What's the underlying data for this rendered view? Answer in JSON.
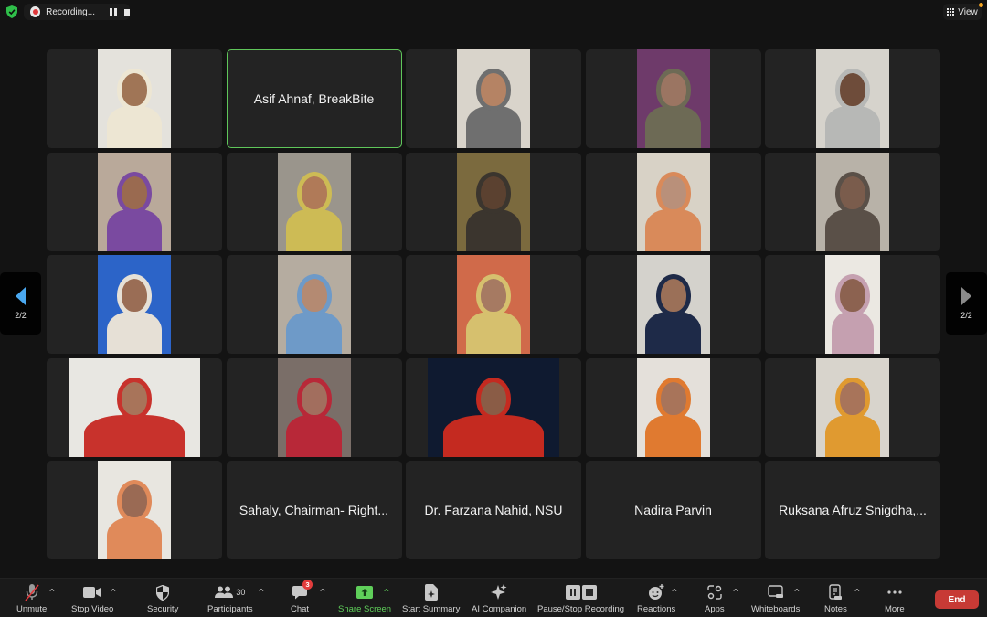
{
  "topbar": {
    "security_icon": "shield-check-icon",
    "recording_label": "Recording...",
    "view_label": "View",
    "view_notification": true
  },
  "pagination": {
    "left_label": "2/2",
    "right_label": "2/2"
  },
  "tiles": [
    {
      "type": "video",
      "name": "",
      "active": false
    },
    {
      "type": "name",
      "name": "Asif Ahnaf, BreakBite",
      "active": true
    },
    {
      "type": "video",
      "name": "",
      "active": false
    },
    {
      "type": "video",
      "name": "",
      "active": false
    },
    {
      "type": "video",
      "name": "",
      "active": false
    },
    {
      "type": "video",
      "name": "",
      "active": false
    },
    {
      "type": "video",
      "name": "",
      "active": false
    },
    {
      "type": "video",
      "name": "",
      "active": false
    },
    {
      "type": "video",
      "name": "",
      "active": false
    },
    {
      "type": "video",
      "name": "",
      "active": false
    },
    {
      "type": "video",
      "name": "",
      "active": false
    },
    {
      "type": "video",
      "name": "",
      "active": false
    },
    {
      "type": "video",
      "name": "",
      "active": false
    },
    {
      "type": "video",
      "name": "",
      "active": false
    },
    {
      "type": "video",
      "name": "",
      "active": false
    },
    {
      "type": "video",
      "name": "",
      "active": false
    },
    {
      "type": "video",
      "name": "",
      "active": false
    },
    {
      "type": "video",
      "name": "",
      "active": false
    },
    {
      "type": "video",
      "name": "",
      "active": false
    },
    {
      "type": "video",
      "name": "",
      "active": false
    },
    {
      "type": "video",
      "name": "",
      "active": false
    },
    {
      "type": "name",
      "name": "Sahaly, Chairman- Right...",
      "active": false
    },
    {
      "type": "name",
      "name": "Dr. Farzana Nahid, NSU",
      "active": false
    },
    {
      "type": "name",
      "name": "Nadira Parvin",
      "active": false
    },
    {
      "type": "name",
      "name": "Ruksana Afruz Snigdha,...",
      "active": false
    }
  ],
  "toolbar": {
    "unmute": "Unmute",
    "stop_video": "Stop Video",
    "security": "Security",
    "participants": "Participants",
    "participants_count": "30",
    "chat": "Chat",
    "chat_badge": "3",
    "share_screen": "Share Screen",
    "start_summary": "Start Summary",
    "ai_companion": "AI Companion",
    "pause_stop_recording": "Pause/Stop Recording",
    "reactions": "Reactions",
    "apps": "Apps",
    "whiteboards": "Whiteboards",
    "notes": "Notes",
    "more": "More",
    "end": "End"
  },
  "colors": {
    "active_speaker": "#5fc65a",
    "share_green": "#5fcf5a",
    "end_red": "#c73a35",
    "recording_red": "#e0383b",
    "pager_blue": "#4aa8f0"
  }
}
